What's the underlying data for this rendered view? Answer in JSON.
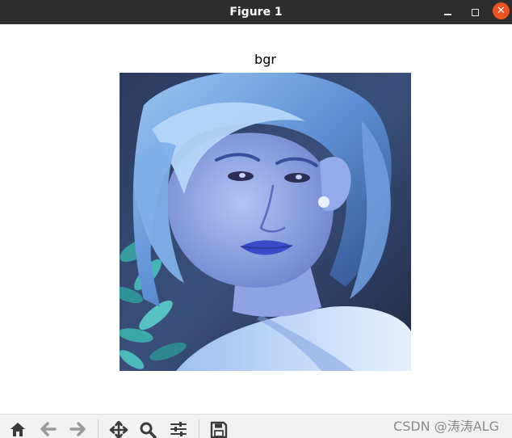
{
  "window": {
    "title": "Figure 1",
    "buttons": [
      "minimize-icon",
      "maximize-icon",
      "close-icon"
    ]
  },
  "figure": {
    "axes_title": "bgr"
  },
  "toolbar": {
    "icons": [
      "home-icon",
      "back-arrow-icon",
      "forward-arrow-icon",
      "pan-icon",
      "zoom-icon",
      "configure-subplots-icon",
      "save-icon"
    ]
  },
  "watermark": {
    "text": "CSDN @涛涛ALG"
  },
  "colors": {
    "titlebar": "#2d2d2d",
    "close_button": "#e95420",
    "toolbar": "#f2f2f2"
  }
}
